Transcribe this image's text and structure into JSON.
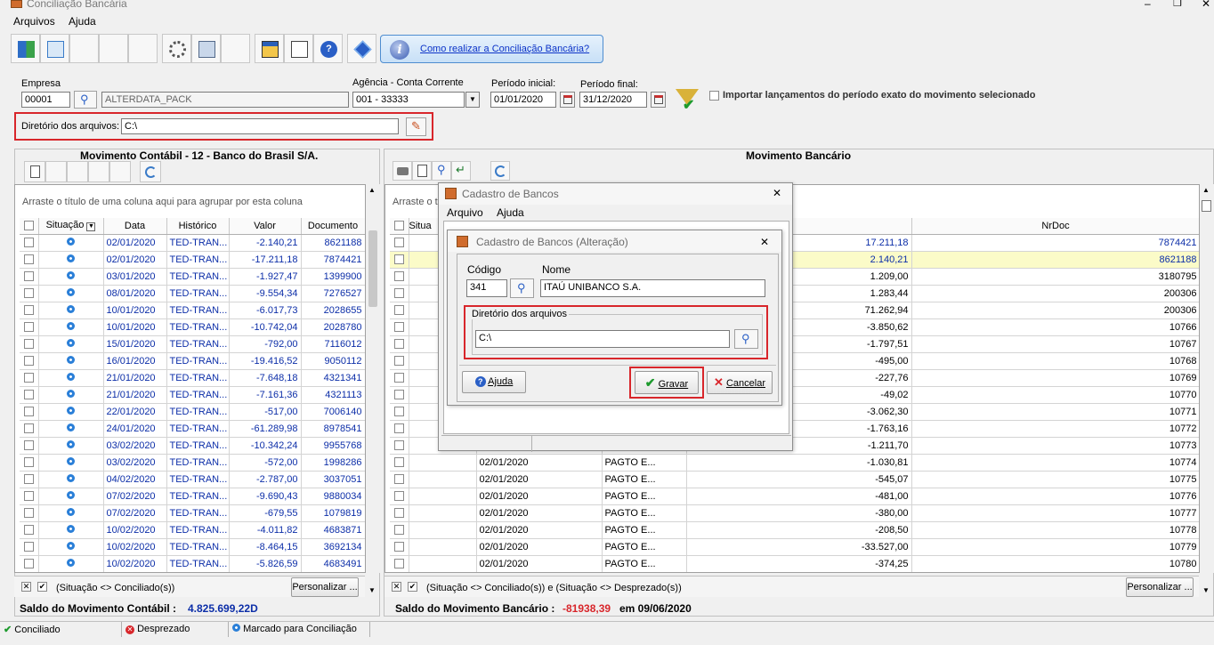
{
  "window": {
    "title": "Conciliação Bancária"
  },
  "menu": [
    "Arquivos",
    "Ajuda"
  ],
  "help_link": "Como realizar a Conciliação Bancária?",
  "form": {
    "empresa_label": "Empresa",
    "empresa_code": "00001",
    "empresa_name": "ALTERDATA_PACK",
    "agencia_label": "Agência - Conta Corrente",
    "agencia_value": "001 - 33333",
    "periodo_inicial_label": "Período inicial:",
    "periodo_inicial": "01/01/2020",
    "periodo_final_label": "Período final:",
    "periodo_final": "31/12/2020",
    "importar_label": "Importar lançamentos do período exato do movimento selecionado",
    "diretorio_label": "Diretório dos arquivos:",
    "diretorio_value": "C:\\"
  },
  "left": {
    "header": "Movimento Contábil - 12 - Banco do Brasil S/A.",
    "group_hint": "Arraste o título de uma coluna aqui para agrupar por esta coluna",
    "columns": [
      "Situação",
      "Data",
      "Histórico",
      "Valor",
      "Documento"
    ],
    "rows": [
      [
        "02/01/2020",
        "TED-TRAN...",
        "-2.140,21",
        "8621188"
      ],
      [
        "02/01/2020",
        "TED-TRAN...",
        "-17.211,18",
        "7874421"
      ],
      [
        "03/01/2020",
        "TED-TRAN...",
        "-1.927,47",
        "1399900"
      ],
      [
        "08/01/2020",
        "TED-TRAN...",
        "-9.554,34",
        "7276527"
      ],
      [
        "10/01/2020",
        "TED-TRAN...",
        "-6.017,73",
        "2028655"
      ],
      [
        "10/01/2020",
        "TED-TRAN...",
        "-10.742,04",
        "2028780"
      ],
      [
        "15/01/2020",
        "TED-TRAN...",
        "-792,00",
        "7116012"
      ],
      [
        "16/01/2020",
        "TED-TRAN...",
        "-19.416,52",
        "9050112"
      ],
      [
        "21/01/2020",
        "TED-TRAN...",
        "-7.648,18",
        "4321341"
      ],
      [
        "21/01/2020",
        "TED-TRAN...",
        "-7.161,36",
        "4321113"
      ],
      [
        "22/01/2020",
        "TED-TRAN...",
        "-517,00",
        "7006140"
      ],
      [
        "24/01/2020",
        "TED-TRAN...",
        "-61.289,98",
        "8978541"
      ],
      [
        "03/02/2020",
        "TED-TRAN...",
        "-10.342,24",
        "9955768"
      ],
      [
        "03/02/2020",
        "TED-TRAN...",
        "-572,00",
        "1998286"
      ],
      [
        "04/02/2020",
        "TED-TRAN...",
        "-2.787,00",
        "3037051"
      ],
      [
        "07/02/2020",
        "TED-TRAN...",
        "-9.690,43",
        "9880034"
      ],
      [
        "07/02/2020",
        "TED-TRAN...",
        "-679,55",
        "1079819"
      ],
      [
        "10/02/2020",
        "TED-TRAN...",
        "-4.011,82",
        "4683871"
      ],
      [
        "10/02/2020",
        "TED-TRAN...",
        "-8.464,15",
        "3692134"
      ],
      [
        "10/02/2020",
        "TED-TRAN...",
        "-5.826,59",
        "4683491"
      ]
    ],
    "filter": "(Situação <> Conciliado(s))",
    "personalizar": "Personalizar ...",
    "saldo_label": "Saldo do Movimento Contábil :",
    "saldo_value": "4.825.699,22D"
  },
  "right": {
    "header": "Movimento Bancário",
    "group_hint": "Arraste o t",
    "col_situacao": "Situa",
    "col_nrdoc": "NrDoc",
    "rows": [
      [
        "",
        "",
        "17.211,18",
        "7874421"
      ],
      [
        "",
        "",
        "2.140,21",
        "8621188"
      ],
      [
        "",
        "",
        "1.209,00",
        "3180795"
      ],
      [
        "",
        "",
        "1.283,44",
        "200306"
      ],
      [
        "",
        "",
        "71.262,94",
        "200306"
      ],
      [
        "",
        "",
        "-3.850,62",
        "10766"
      ],
      [
        "",
        "",
        "-1.797,51",
        "10767"
      ],
      [
        "",
        "",
        "-495,00",
        "10768"
      ],
      [
        "",
        "",
        "-227,76",
        "10769"
      ],
      [
        "",
        "",
        "-49,02",
        "10770"
      ],
      [
        "",
        "",
        "-3.062,30",
        "10771"
      ],
      [
        "",
        "",
        "-1.763,16",
        "10772"
      ],
      [
        "",
        "",
        "-1.211,70",
        "10773"
      ],
      [
        "02/01/2020",
        "PAGTO E...",
        "-1.030,81",
        "10774"
      ],
      [
        "02/01/2020",
        "PAGTO E...",
        "-545,07",
        "10775"
      ],
      [
        "02/01/2020",
        "PAGTO E...",
        "-481,00",
        "10776"
      ],
      [
        "02/01/2020",
        "PAGTO E...",
        "-380,00",
        "10777"
      ],
      [
        "02/01/2020",
        "PAGTO E...",
        "-208,50",
        "10778"
      ],
      [
        "02/01/2020",
        "PAGTO E...",
        "-33.527,00",
        "10779"
      ],
      [
        "02/01/2020",
        "PAGTO E...",
        "-374,25",
        "10780"
      ]
    ],
    "filter": "(Situação <> Conciliado(s)) e (Situação <> Desprezado(s))",
    "personalizar": "Personalizar ...",
    "saldo_label": "Saldo do Movimento Bancário :",
    "saldo_value": "-81938,39",
    "saldo_date": "em 09/06/2020"
  },
  "status": [
    "Conciliado",
    "Desprezado",
    "Marcado para Conciliação"
  ],
  "dialog_bancos": {
    "title": "Cadastro de Bancos",
    "menu": [
      "Arquivo",
      "Ajuda"
    ]
  },
  "dialog_alteracao": {
    "title": "Cadastro de Bancos (Alteração)",
    "codigo_label": "Código",
    "codigo_value": "341",
    "nome_label": "Nome",
    "nome_value": "ITAÚ UNIBANCO S.A.",
    "diretorio_label": "Diretório dos arquivos",
    "diretorio_value": "C:\\",
    "ajuda": "Ajuda",
    "gravar": "Gravar",
    "cancelar": "Cancelar"
  },
  "colors": {
    "accent_red": "#d8262b",
    "link_blue": "#0c33c8",
    "highlight_row": "#fbfbc8"
  }
}
